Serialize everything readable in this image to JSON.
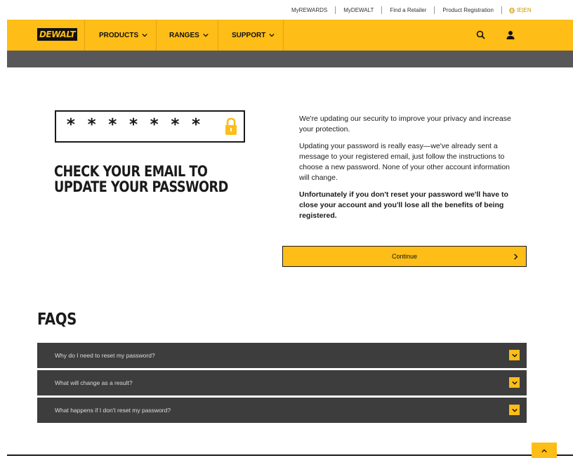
{
  "utility": {
    "links": [
      "MyREWARDS",
      "MyDEWALT",
      "Find a Retailer",
      "Product Registration"
    ],
    "lang": "IE|EN"
  },
  "nav": {
    "logo": "DEWALT",
    "items": [
      "PRODUCTS",
      "RANGES",
      "SUPPORT"
    ]
  },
  "hero": {
    "password_mask": "* * * * * * *",
    "headline_line1": "CHECK YOUR EMAIL TO",
    "headline_line2": "UPDATE YOUR PASSWORD"
  },
  "copy": {
    "p1": "We're updating our security to improve your privacy and increase your protection.",
    "p2": "Updating your password is really easy—we've already sent a message to your registered email, just follow the instructions to choose a new password. None of your other account information will change.",
    "p3": "Unfortunately if you don't reset your password we'll have to close your account and you'll lose all the benefits of being registered."
  },
  "continue_label": "Continue",
  "faq": {
    "title": "FAQS",
    "items": [
      "Why do I need to reset my password?",
      "What will change as a result?",
      "What happens if I don't reset my password?"
    ]
  },
  "colors": {
    "brand_yellow": "#febd17",
    "dark_gray": "#3d3d3d",
    "band_gray": "#58585a"
  }
}
